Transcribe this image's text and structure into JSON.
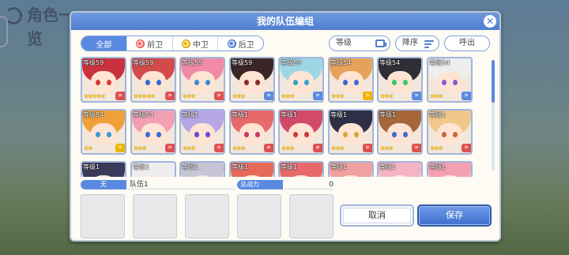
{
  "background": {
    "screen_title": "角色一览"
  },
  "dialog": {
    "title": "我的队伍编组",
    "close_icon": "close-icon"
  },
  "filters": {
    "tabs": [
      {
        "label": "全部",
        "active": true,
        "icon": null
      },
      {
        "label": "前卫",
        "active": false,
        "icon": "frontline-icon"
      },
      {
        "label": "中卫",
        "active": false,
        "icon": "midline-icon"
      },
      {
        "label": "后卫",
        "active": false,
        "icon": "backline-icon"
      }
    ],
    "sort_label": "等级",
    "order_label": "降序",
    "callout_label": "呼出"
  },
  "roster": [
    {
      "level": "等级59",
      "stars": "★★★★★",
      "hair": "#c8323c",
      "eye": "#d63a3a",
      "chev": "#e05050"
    },
    {
      "level": "等级59",
      "stars": "★★★★★",
      "hair": "#d24a4a",
      "eye": "#2e6ad6",
      "chev": "#e05050"
    },
    {
      "level": "等级59",
      "stars": "★★★",
      "hair": "#f08aa6",
      "eye": "#3a8ad6",
      "chev": "#e05050"
    },
    {
      "level": "等级59",
      "stars": "★★★",
      "hair": "#3a2626",
      "eye": "#8a2a2a",
      "chev": "#5a8ae0"
    },
    {
      "level": "等级59",
      "stars": "★★★",
      "hair": "#9fd6e6",
      "eye": "#2ea6c6",
      "chev": "#5a8ae0"
    },
    {
      "level": "等级54",
      "stars": "★★★",
      "hair": "#e6a25a",
      "eye": "#3a6ad6",
      "chev": "#f0b400"
    },
    {
      "level": "等级54",
      "stars": "★★★",
      "hair": "#2e2e36",
      "eye": "#3ac66a",
      "chev": "#5a8ae0"
    },
    {
      "level": "等级54",
      "stars": "★★★",
      "hair": "#eeeeee",
      "eye": "#8a5ad6",
      "chev": "#5a8ae0"
    },
    {
      "level": "等级54",
      "stars": "★★",
      "hair": "#f0a03a",
      "eye": "#3a9ad6",
      "chev": "#f0b400"
    },
    {
      "level": "等级54",
      "stars": "★★★",
      "hair": "#f4a0b4",
      "eye": "#3a6ad6",
      "chev": "#e05050"
    },
    {
      "level": "等级1",
      "stars": "★★★",
      "hair": "#b6a6e6",
      "eye": "#6a4ad6",
      "chev": "#e05050"
    },
    {
      "level": "等级1",
      "stars": "★★★",
      "hair": "#e66a6a",
      "eye": "#c63a6a",
      "chev": "#e05050"
    },
    {
      "level": "等级1",
      "stars": "★★★",
      "hair": "#d24a6a",
      "eye": "#c63a3a",
      "chev": "#e05050"
    },
    {
      "level": "等级1",
      "stars": "★★★",
      "hair": "#2e2e46",
      "eye": "#d6a63a",
      "chev": "#e05050"
    },
    {
      "level": "等级1",
      "stars": "★★★",
      "hair": "#a6663a",
      "eye": "#3a6ad6",
      "chev": "#e05050"
    },
    {
      "level": "等级1",
      "stars": "★★★",
      "hair": "#f0c88a",
      "eye": "#c6663a",
      "chev": "#e05050"
    },
    {
      "level": "等级1",
      "stars": "",
      "hair": "#3a3a5a",
      "eye": "#5a5ad6",
      "chev": "#5a8ae0"
    },
    {
      "level": "等级1",
      "stars": "",
      "hair": "#eeeeee",
      "eye": "#5a8ad6",
      "chev": "#5a8ae0"
    },
    {
      "level": "等级1",
      "stars": "",
      "hair": "#c6c6d6",
      "eye": "#5a5ad6",
      "chev": "#5a8ae0"
    },
    {
      "level": "等级1",
      "stars": "",
      "hair": "#e66a5a",
      "eye": "#c63a3a",
      "chev": "#e05050"
    },
    {
      "level": "等级1",
      "stars": "",
      "hair": "#e66a6a",
      "eye": "#c63a3a",
      "chev": "#e05050"
    },
    {
      "level": "等级1",
      "stars": "",
      "hair": "#f0a0a0",
      "eye": "#c63a6a",
      "chev": "#e05050"
    },
    {
      "level": "等级1",
      "stars": "",
      "hair": "#f4b4c4",
      "eye": "#c63a6a",
      "chev": "#e05050"
    },
    {
      "level": "等级1",
      "stars": "",
      "hair": "#f4a0b0",
      "eye": "#c63a6a",
      "chev": "#e05050"
    }
  ],
  "party": {
    "badge": "无",
    "name": "队伍1",
    "power_label": "总战力",
    "power_value": "0"
  },
  "actions": {
    "cancel_label": "取消",
    "save_label": "保存"
  },
  "colors": {
    "accent": "#5a8ae0",
    "header": "#4f7fcf"
  }
}
